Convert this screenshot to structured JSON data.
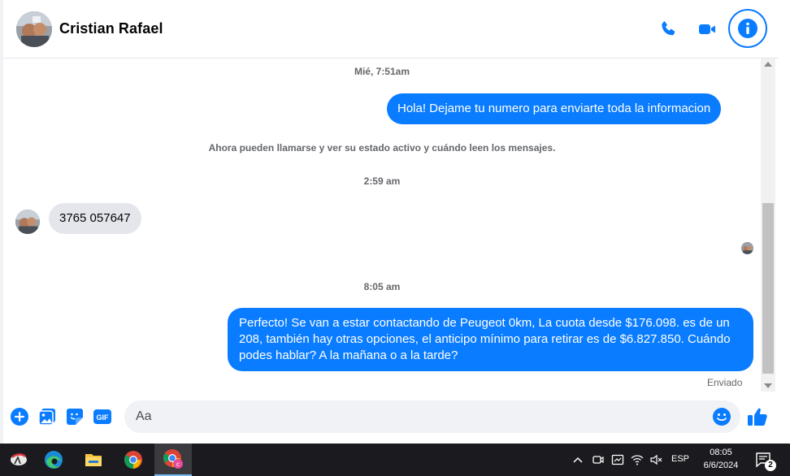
{
  "header": {
    "contact_name": "Cristian Rafael",
    "icons": [
      "phone-icon",
      "video-camera-icon",
      "info-icon"
    ]
  },
  "thread": {
    "items": [
      {
        "kind": "timestamp",
        "text": "Mié, 7:51am"
      },
      {
        "kind": "message",
        "direction": "outgoing",
        "text": "Hola! Dejame tu numero para enviarte toda la informacion"
      },
      {
        "kind": "system",
        "text": "Ahora pueden llamarse y ver su estado activo y cuándo leen los mensajes."
      },
      {
        "kind": "timestamp",
        "text": "2:59 am"
      },
      {
        "kind": "message",
        "direction": "incoming",
        "text": "3765 057647"
      },
      {
        "kind": "timestamp",
        "text": "8:05 am"
      },
      {
        "kind": "message",
        "direction": "outgoing",
        "text": "Perfecto!  Se van a estar contactando de Peugeot 0km, La cuota desde $176.098. es de un 208, también hay otras opciones, el anticipo mínimo para retirar es de $6.827.850. Cuándo podes hablar? A la mañana o a la tarde?"
      }
    ],
    "last_status": "Enviado"
  },
  "composer": {
    "placeholder": "Aa",
    "value": "",
    "icons": [
      "plus-icon",
      "photo-icon",
      "sticker-icon",
      "gif-icon",
      "emoji-icon",
      "thumbs-up-icon"
    ]
  },
  "taskbar": {
    "apps": [
      "settings-app-icon",
      "edge-icon",
      "file-explorer-icon",
      "chrome-icon",
      "chrome-profile-icon"
    ],
    "language": "ESP",
    "time": "08:05",
    "date": "6/6/2024",
    "notification_count": "2"
  },
  "colors": {
    "accent": "#0a7cff",
    "incoming_bubble": "#e4e6eb",
    "secondary_text": "#65676b"
  }
}
